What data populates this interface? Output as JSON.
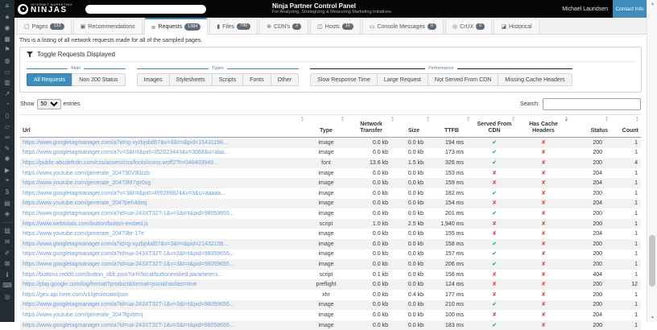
{
  "colors": {
    "accent": "#3c8dbc",
    "topbar": "#050505",
    "sidebar": "#222d32",
    "link": "#6d9ed8",
    "check_green": "#00a65a",
    "cross_red": "#d9534f",
    "badge": "#5f6b78"
  },
  "glyphs": {
    "check": "✔",
    "cross": "✘",
    "sort_up": "▲",
    "sort_down": "▼",
    "scroll_up": "▲",
    "scroll_down": "▼"
  },
  "sidebar": {
    "icons": [
      {
        "name": "menu-icon",
        "glyph": "≡",
        "active": true
      },
      {
        "name": "star-icon",
        "glyph": "★"
      },
      {
        "name": "dashboard-icon",
        "glyph": "◉"
      },
      {
        "name": "building-icon",
        "glyph": "▦"
      },
      {
        "name": "running-icon",
        "glyph": "⚑"
      },
      {
        "name": "globe-icon",
        "glyph": "◍"
      },
      {
        "name": "tv-icon",
        "glyph": "▭"
      },
      {
        "name": "bar-chart-icon",
        "glyph": "▥"
      },
      {
        "name": "line-chart-icon",
        "glyph": "↗"
      },
      {
        "name": "binoculars-icon",
        "glyph": "◔"
      },
      {
        "name": "laptop-icon",
        "glyph": "▯"
      },
      {
        "name": "mobile-icon",
        "glyph": "▱"
      },
      {
        "name": "link-icon",
        "glyph": "∞"
      },
      {
        "name": "pencil-icon",
        "glyph": "✎"
      },
      {
        "name": "tools-icon",
        "glyph": "✱"
      },
      {
        "name": "video-icon",
        "glyph": "▶"
      },
      {
        "name": "comment-icon",
        "glyph": "❝"
      },
      {
        "name": "dollar-icon",
        "glyph": "$"
      },
      {
        "name": "file-icon",
        "glyph": "▤"
      },
      {
        "name": "certificate-icon",
        "glyph": "◈"
      },
      {
        "divider": true
      },
      {
        "name": "document-icon",
        "glyph": "▧"
      },
      {
        "name": "envelope-icon",
        "glyph": "✉"
      },
      {
        "name": "edit-icon",
        "glyph": "✐"
      },
      {
        "name": "lock-icon",
        "glyph": "⊠"
      },
      {
        "name": "info-icon",
        "glyph": "ℹ"
      },
      {
        "name": "keyboard-icon",
        "glyph": "⌨"
      },
      {
        "name": "camera-icon",
        "glyph": "◎"
      }
    ]
  },
  "topbar": {
    "brand_top": "INTERNET MARKETING",
    "brand": "NINJAS",
    "title": "Ninja Partner Control Panel",
    "subtitle": "For Analyzing, Strategizing & Measuring Marketing Initiatives",
    "user": "Michael Lauridsen",
    "contact_button": "Contact Info"
  },
  "tabs": [
    {
      "id": "pages",
      "label": "Pages",
      "badge": "133",
      "glyph": "▢",
      "active": false
    },
    {
      "id": "recommendations",
      "label": "Recommendations",
      "badge": null,
      "glyph": "▣",
      "active": false
    },
    {
      "id": "requests",
      "label": "Requests",
      "badge": "1384",
      "glyph": "≣",
      "active": true
    },
    {
      "id": "files",
      "label": "Files",
      "badge": "790",
      "glyph": "▮",
      "active": false
    },
    {
      "id": "cdns",
      "label": "CDN's",
      "badge": "2",
      "glyph": "⊕",
      "active": false
    },
    {
      "id": "hosts",
      "label": "Hosts",
      "badge": "10",
      "glyph": "◫",
      "active": false
    },
    {
      "id": "console-messages",
      "label": "Console Messages",
      "badge": "0",
      "glyph": "▭",
      "active": false
    },
    {
      "id": "crux",
      "label": "CrUX",
      "badge": "0",
      "glyph": "◎",
      "active": false
    },
    {
      "id": "historical",
      "label": "Historical",
      "badge": null,
      "glyph": "◪",
      "active": false
    }
  ],
  "description": "This is a listing of all network requests made for all of the sampled pages.",
  "filter_panel": {
    "title": "Toggle Requests Displayed",
    "groups": [
      {
        "label": "Main",
        "buttons": [
          {
            "label": "All Requests",
            "active": true
          },
          {
            "label": "Non 200 Status",
            "active": false
          }
        ]
      },
      {
        "label": "Types",
        "buttons": [
          {
            "label": "Images",
            "active": false
          },
          {
            "label": "Stylesheets",
            "active": false
          },
          {
            "label": "Scripts",
            "active": false
          },
          {
            "label": "Fonts",
            "active": false
          },
          {
            "label": "Other",
            "active": false
          }
        ]
      },
      {
        "label": "Performance",
        "buttons": [
          {
            "label": "Slow Response Time",
            "active": false
          },
          {
            "label": "Large Request",
            "active": false
          },
          {
            "label": "Not Served From CDN",
            "active": false
          },
          {
            "label": "Missing Cache Headers",
            "active": false
          }
        ]
      }
    ]
  },
  "controls": {
    "show_label": "Show",
    "page_size": "50",
    "entries_label": "entries",
    "search_label": "Search:",
    "search_value": ""
  },
  "table": {
    "columns": [
      {
        "label": "Url",
        "align": "left",
        "sort": "both"
      },
      {
        "label": "Type",
        "align": "ctr",
        "sort": "both"
      },
      {
        "label": "Network Transfer",
        "align": "ctr",
        "sort": "both"
      },
      {
        "label": "Size",
        "align": "ctr",
        "sort": "both"
      },
      {
        "label": "TTFB",
        "align": "ctr",
        "sort": "both"
      },
      {
        "label": "Served From CDN",
        "align": "ctr",
        "sort": "both"
      },
      {
        "label": "Has Cache Headers",
        "align": "ctr",
        "sort": "desc"
      },
      {
        "label": "Status",
        "align": "rgt",
        "sort": "both"
      },
      {
        "label": "Count",
        "align": "rgt",
        "sort": "both"
      }
    ],
    "rows": [
      {
        "url": "https://www.googletagmanager.com/a?id=g-xyzbjsbd07&v=3&t=t&pid=15431198...",
        "type": "image",
        "transfer": "0.0 kb",
        "size": "0.0 kb",
        "ttfb": "194 ms",
        "cdn": true,
        "cache": false,
        "status": "200",
        "count": "1"
      },
      {
        "url": "https://www.googletagmanager.com/a?v=3&t=t&pid=352023443&v=3088&u=aaa...",
        "type": "image",
        "transfer": "0.0 kb",
        "size": "0.0 kb",
        "ttfb": "173 ms",
        "cdn": true,
        "cache": false,
        "status": "200",
        "count": "1"
      },
      {
        "url": "https://public-abcdefcdn.com/css/assets/css/fonts/icons.woff2?h=049403949...",
        "type": "font",
        "transfer": "13.6 kb",
        "size": "1.5 kb",
        "ttfb": "326 ms",
        "cdn": true,
        "cache": false,
        "status": "200",
        "count": "4"
      },
      {
        "url": "https://www.youtube.com/generate_204?30V90zzb",
        "type": "image",
        "transfer": "0.0 kb",
        "size": "0.0 kb",
        "ttfb": "153 ms",
        "cdn": false,
        "cache": false,
        "status": "204",
        "count": "1"
      },
      {
        "url": "https://www.youtube.com/generate_204?3M7qv0sg",
        "type": "image",
        "transfer": "0.0 kb",
        "size": "0.0 kb",
        "ttfb": "159 ms",
        "cdn": false,
        "cache": false,
        "status": "204",
        "count": "1"
      },
      {
        "url": "https://www.googletagmanager.com/a?v=3&t=t&pid=495289824&v=3&u=aaaaa...",
        "type": "image",
        "transfer": "0.0 kb",
        "size": "0.0 kb",
        "ttfb": "182 ms",
        "cdn": true,
        "cache": false,
        "status": "200",
        "count": "1"
      },
      {
        "url": "https://www.youtube.com/generate_204?peh4deq",
        "type": "image",
        "transfer": "0.0 kb",
        "size": "0.0 kb",
        "ttfb": "154 ms",
        "cdn": false,
        "cache": false,
        "status": "204",
        "count": "1"
      },
      {
        "url": "https://www.googletagmanager.com/a?id=ua-243XT32T-1&v=3&t=t&pid=98059655...",
        "type": "image",
        "transfer": "0.0 kb",
        "size": "0.0 kb",
        "ttfb": "201 ms",
        "cdn": true,
        "cache": false,
        "status": "200",
        "count": "1"
      },
      {
        "url": "https://www.webtotals.com/button/button-embed.js",
        "type": "script",
        "transfer": "1.0 kb",
        "size": "2.5 kb",
        "ttfb": "1,940 ms",
        "cdn": false,
        "cache": false,
        "status": "200",
        "count": "1"
      },
      {
        "url": "https://www.youtube.com/generate_204?3br-17e",
        "type": "image",
        "transfer": "0.0 kb",
        "size": "0.0 kb",
        "ttfb": "155 ms",
        "cdn": false,
        "cache": false,
        "status": "204",
        "count": "1"
      },
      {
        "url": "https://www.googletagmanager.com/a?id=g-xyzbjsbd07&v=3&t=t&pid=21432198...",
        "type": "image",
        "transfer": "0.0 kb",
        "size": "0.0 kb",
        "ttfb": "158 ms",
        "cdn": true,
        "cache": false,
        "status": "200",
        "count": "1"
      },
      {
        "url": "https://www.googletagmanager.com/a?id=ua-243XT32T-1&v=3&t=t&pid=98059655...",
        "type": "image",
        "transfer": "0.0 kb",
        "size": "0.0 kb",
        "ttfb": "157 ms",
        "cdn": true,
        "cache": false,
        "status": "200",
        "count": "1"
      },
      {
        "url": "https://www.googletagmanager.com/a?id=ua-243XT32T-1&v=3&t=t&pid=98059655...",
        "type": "image",
        "transfer": "0.0 kb",
        "size": "0.0 kb",
        "ttfb": "206 ms",
        "cdn": true,
        "cache": false,
        "status": "200",
        "count": "1"
      },
      {
        "url": "https://buttons.reddit.com/button_obb.json?url=/local/buttonembed.parameters...",
        "type": "script",
        "transfer": "0.1 kb",
        "size": "0.0 kb",
        "ttfb": "156 ms",
        "cdn": false,
        "cache": false,
        "status": "404",
        "count": "1"
      },
      {
        "url": "https://play.google.com/log/format?product&format=json&hasfast=true",
        "type": "preflight",
        "transfer": "0.0 kb",
        "size": "0.0 kb",
        "ttfb": "124 ms",
        "cdn": false,
        "cache": false,
        "status": "200",
        "count": "12"
      },
      {
        "url": "https://geo.api.here.com/v1/geolocate/json",
        "type": "xhr",
        "transfer": "0.0 kb",
        "size": "0.4 kb",
        "ttfb": "177 ms",
        "cdn": false,
        "cache": false,
        "status": "200",
        "count": "1"
      },
      {
        "url": "https://www.googletagmanager.com/a?id=ua-243XT32T-1&v=3&t=t&pid=98059655...",
        "type": "image",
        "transfer": "0.0 kb",
        "size": "0.0 kb",
        "ttfb": "210 ms",
        "cdn": true,
        "cache": false,
        "status": "200",
        "count": "1"
      },
      {
        "url": "https://www.youtube.com/generate_204?fgvbtmj",
        "type": "image",
        "transfer": "0.0 kb",
        "size": "0.0 kb",
        "ttfb": "100 ms",
        "cdn": false,
        "cache": false,
        "status": "204",
        "count": "1"
      },
      {
        "url": "https://www.googletagmanager.com/a?id=ua-243XT32T-1&v=3&t=t&pid=98059655...",
        "type": "image",
        "transfer": "0.0 kb",
        "size": "0.0 kb",
        "ttfb": "183 ms",
        "cdn": true,
        "cache": false,
        "status": "200",
        "count": "1"
      }
    ]
  }
}
